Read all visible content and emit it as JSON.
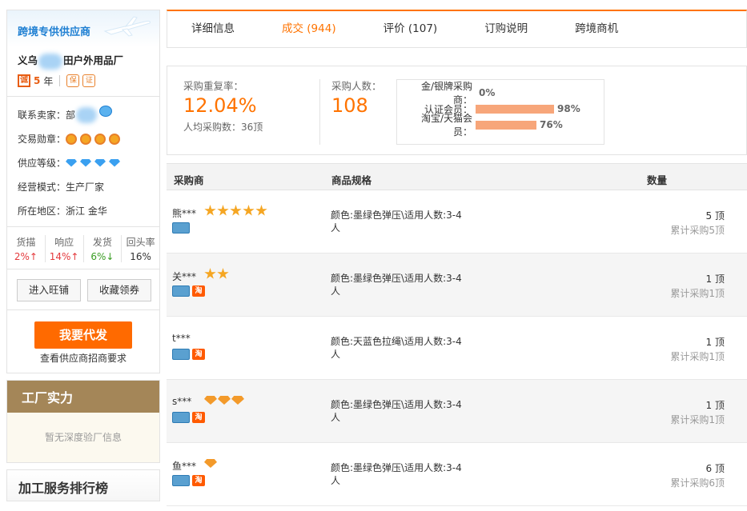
{
  "supplier": {
    "banner_title": "跨境专供供应商",
    "company_name_prefix": "义乌",
    "company_name_suffix": "田户外用品厂",
    "years_badge": "诚",
    "years_value": "5",
    "years_unit": "年",
    "contact_label": "联系卖家：",
    "contact_name": "部",
    "medal_label": "交易勋章：",
    "level_label": "供应等级：",
    "mode_label": "经营模式：",
    "mode_value": "生产厂家",
    "region_label": "所在地区：",
    "region_value": "浙江 金华",
    "stats": [
      {
        "label": "货描",
        "value": "2%↑",
        "color": "red"
      },
      {
        "label": "响应",
        "value": "14%↑",
        "color": "red"
      },
      {
        "label": "发货",
        "value": "6%↓",
        "color": "green"
      },
      {
        "label": "回头率",
        "value": "16%",
        "color": "neutral"
      }
    ],
    "btn_wangpu": "进入旺铺",
    "btn_collect": "收藏领券",
    "cta_label": "我要代发",
    "cta_sub": "查看供应商招商要求"
  },
  "factory": {
    "title": "工厂实力",
    "empty_text": "暂无深度验厂信息"
  },
  "ranking": {
    "title": "加工服务排行榜"
  },
  "tabs": [
    {
      "label": "详细信息",
      "active": false
    },
    {
      "label": "成交 (944)",
      "active": true
    },
    {
      "label": "评价 (107)",
      "active": false
    },
    {
      "label": "订购说明",
      "active": false
    },
    {
      "label": "跨境商机",
      "active": false
    }
  ],
  "summary": {
    "repeat_label": "采购重复率：",
    "repeat_value": "12.04%",
    "avg_label": "人均采购数：36顶",
    "buyers_label": "采购人数：",
    "buyers_value": "108",
    "dist": [
      {
        "label": "金/银牌采购商：",
        "value": "0%",
        "fraction": 0.0
      },
      {
        "label": "认证会员：",
        "value": "98%",
        "fraction": 0.98
      },
      {
        "label": "淘宝/天猫会员：",
        "value": "76%",
        "fraction": 0.76
      }
    ]
  },
  "table": {
    "col_buyer": "采购商",
    "col_spec": "商品规格",
    "col_qty": "数量",
    "rows": [
      {
        "buyer": "熊***",
        "rank_type": "star",
        "rank_count": 5,
        "verified": true,
        "taobao": false,
        "spec": "颜色:墨绿色弹压\\适用人数:3-4人",
        "qty": "5 顶",
        "total": "累计采购5顶"
      },
      {
        "buyer": "关***",
        "rank_type": "star",
        "rank_count": 2,
        "verified": true,
        "taobao": true,
        "spec": "颜色:墨绿色弹压\\适用人数:3-4人",
        "qty": "1 顶",
        "total": "累计采购1顶"
      },
      {
        "buyer": "t***",
        "rank_type": "none",
        "rank_count": 0,
        "verified": true,
        "taobao": true,
        "spec": "颜色:天蓝色拉绳\\适用人数:3-4人",
        "qty": "1 顶",
        "total": "累计采购1顶"
      },
      {
        "buyer": "s***",
        "rank_type": "gem",
        "rank_count": 3,
        "verified": true,
        "taobao": true,
        "spec": "颜色:墨绿色弹压\\适用人数:3-4人",
        "qty": "1 顶",
        "total": "累计采购1顶"
      },
      {
        "buyer": "鱼***",
        "rank_type": "gem",
        "rank_count": 1,
        "verified": true,
        "taobao": true,
        "spec": "颜色:墨绿色弹压\\适用人数:3-4人",
        "qty": "6 顶",
        "total": "累计采购6顶"
      }
    ]
  },
  "colors": {
    "accent": "#ff7300",
    "cta": "#ff6a00",
    "factory_header": "#a48658",
    "bar": "#f7a67a"
  }
}
